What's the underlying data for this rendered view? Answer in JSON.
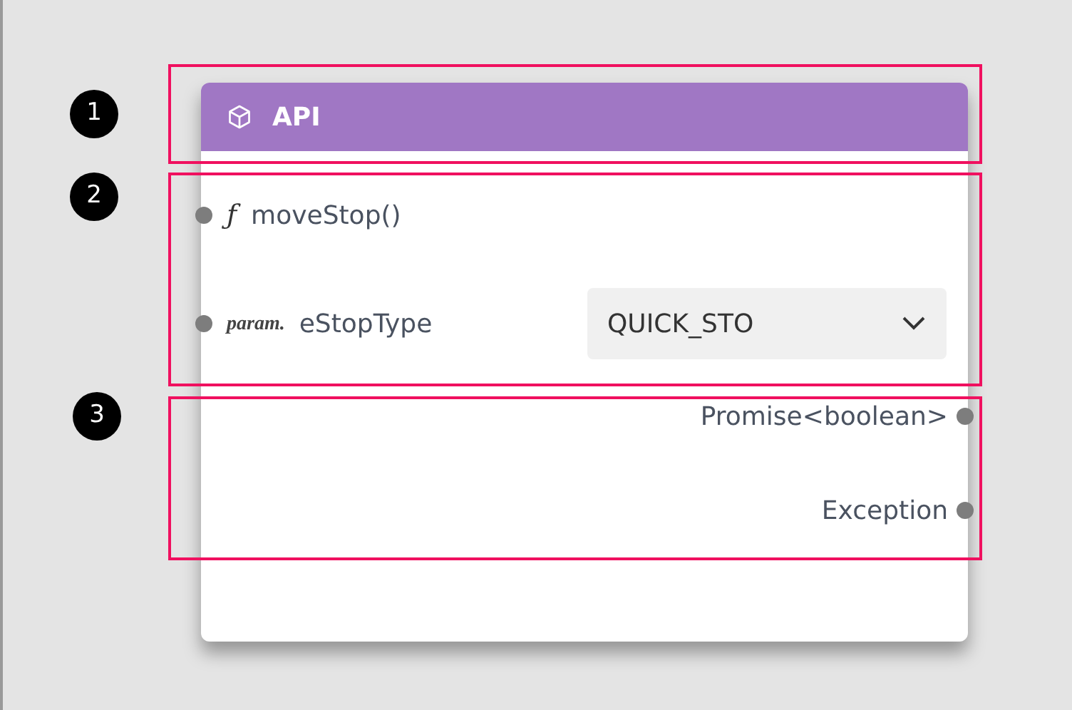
{
  "node": {
    "title": "API",
    "inputs": [
      {
        "kind": "function",
        "prefix": "ƒ",
        "name": "moveStop()"
      },
      {
        "kind": "param",
        "prefix": "param.",
        "name": "eStopType",
        "value": "QUICK_STO"
      }
    ],
    "outputs": [
      {
        "name": "Promise<boolean>"
      },
      {
        "name": "Exception"
      }
    ]
  },
  "callouts": [
    {
      "label": "1"
    },
    {
      "label": "2"
    },
    {
      "label": "3"
    }
  ]
}
